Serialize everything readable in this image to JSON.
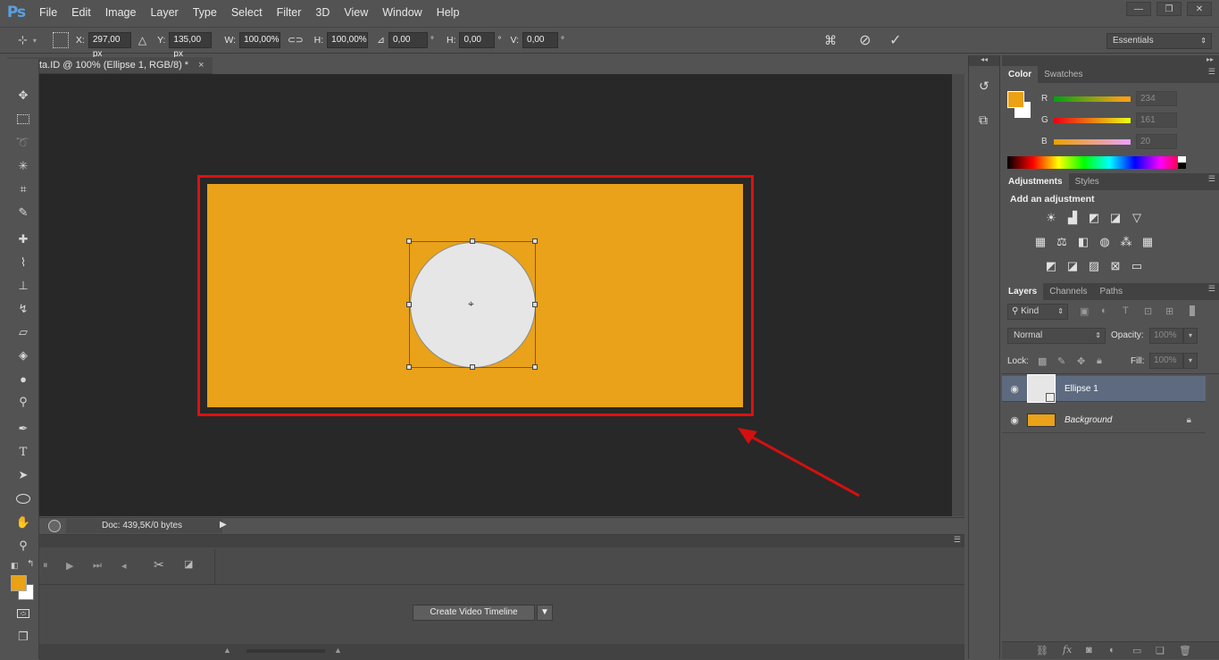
{
  "app": {
    "logo": "Ps",
    "menu": [
      "File",
      "Edit",
      "Image",
      "Layer",
      "Type",
      "Select",
      "Filter",
      "3D",
      "View",
      "Window",
      "Help"
    ],
    "window_buttons": [
      "—",
      "❐",
      "✕"
    ]
  },
  "options": {
    "x_label": "X:",
    "x_value": "297,00 px",
    "y_label": "Y:",
    "y_value": "135,00 px",
    "w_label": "W:",
    "w_value": "100,00%",
    "h_label": "H:",
    "h_value": "100,00%",
    "angle_value": "0,00",
    "deg": "°",
    "hskew_label": "H:",
    "hskew_value": "0,00",
    "vskew_label": "V:",
    "vskew_value": "0,00",
    "workspace": "Essentials"
  },
  "document": {
    "tab_title": "ta.ID @ 100% (Ellipse 1, RGB/8) *",
    "status": "Doc: 439,5K/0 bytes",
    "canvas_color": "#e9a219",
    "ellipse_color": "#e6e6e6",
    "annotation_color": "#e01010"
  },
  "timeline": {
    "create_button": "Create Video Timeline"
  },
  "color_panel": {
    "tabs": [
      "Color",
      "Swatches"
    ],
    "fg_color": "#eaa114",
    "r_label": "R",
    "r_value": "234",
    "g_label": "G",
    "g_value": "161",
    "b_label": "B",
    "b_value": "20"
  },
  "adjustments_panel": {
    "tabs": [
      "Adjustments",
      "Styles"
    ],
    "heading": "Add an adjustment"
  },
  "layers_panel": {
    "tabs": [
      "Layers",
      "Channels",
      "Paths"
    ],
    "kind": "Kind",
    "blend_mode": "Normal",
    "opacity_label": "Opacity:",
    "opacity_value": "100%",
    "lock_label": "Lock:",
    "fill_label": "Fill:",
    "fill_value": "100%",
    "layers": [
      {
        "name": "Ellipse 1",
        "selected": true
      },
      {
        "name": "Background",
        "selected": false,
        "locked": true
      }
    ],
    "footer_icons": [
      "link-icon",
      "fx-icon",
      "mask-icon",
      "adjustment-icon",
      "folder-icon",
      "new-layer-icon",
      "trash-icon"
    ]
  }
}
